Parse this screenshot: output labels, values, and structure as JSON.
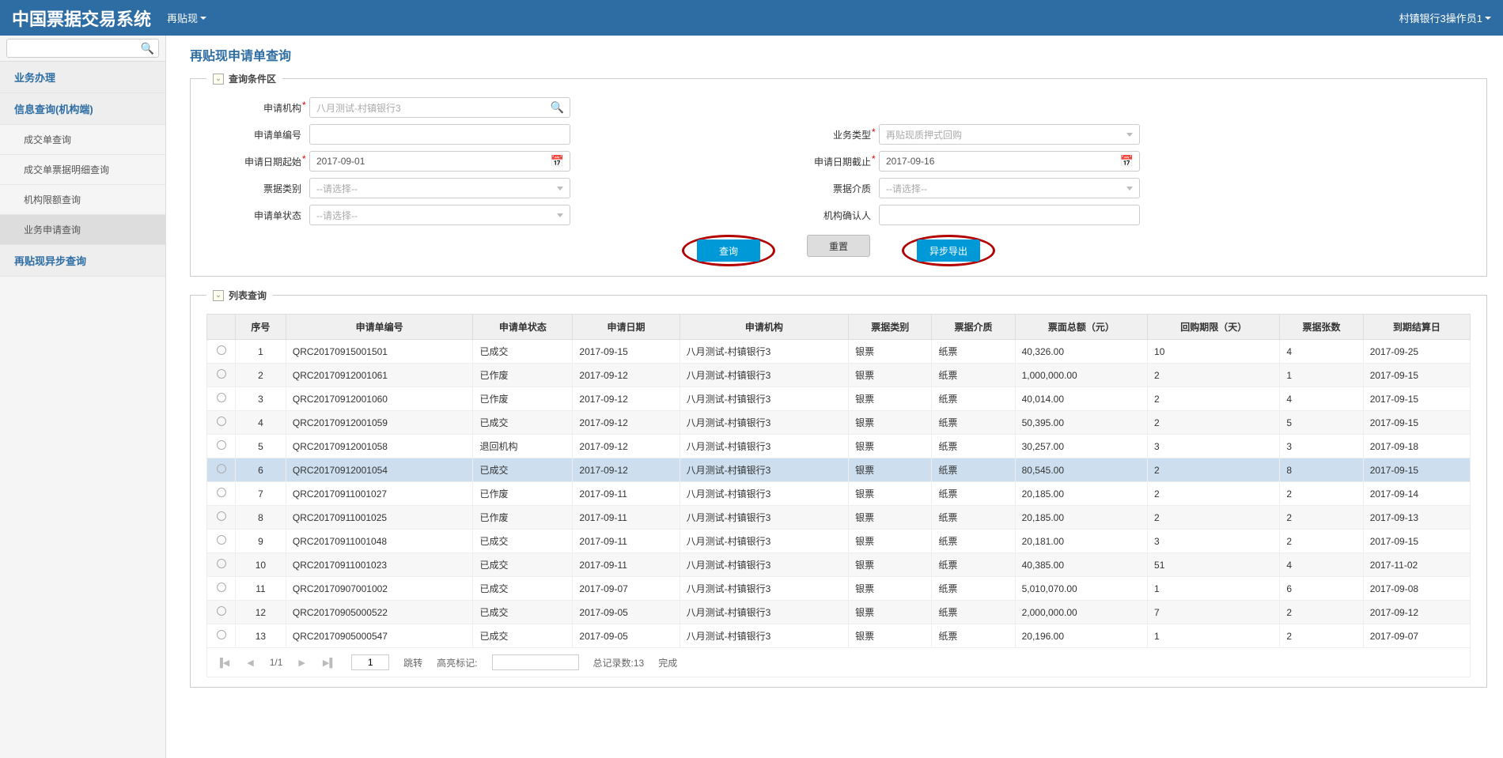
{
  "header": {
    "title": "中国票据交易系统",
    "menu": "再贴现",
    "user": "村镇银行3操作员1"
  },
  "sidebar": {
    "search_placeholder": "",
    "items": [
      {
        "label": "业务办理",
        "type": "bold"
      },
      {
        "label": "信息查询(机构端)",
        "type": "bold"
      },
      {
        "label": "成交单查询",
        "type": "sub"
      },
      {
        "label": "成交单票据明细查询",
        "type": "sub"
      },
      {
        "label": "机构限额查询",
        "type": "sub"
      },
      {
        "label": "业务申请查询",
        "type": "sub",
        "active": true
      },
      {
        "label": "再贴现异步查询",
        "type": "bold"
      }
    ]
  },
  "page": {
    "title": "再贴现申请单查询",
    "query_legend": "查询条件区",
    "list_legend": "列表查询"
  },
  "form": {
    "labels": {
      "apply_org": "申请机构",
      "apply_no": "申请单编号",
      "biz_type": "业务类型",
      "date_from": "申请日期起始",
      "date_to": "申请日期截止",
      "ticket_class": "票据类别",
      "ticket_medium": "票据介质",
      "apply_status": "申请单状态",
      "org_confirm": "机构确认人"
    },
    "values": {
      "apply_org": "八月测试-村镇银行3",
      "apply_no": "",
      "biz_type": "再贴现质押式回购",
      "date_from": "2017-09-01",
      "date_to": "2017-09-16",
      "ticket_class": "--请选择--",
      "ticket_medium": "--请选择--",
      "apply_status": "--请选择--",
      "org_confirm": ""
    },
    "buttons": {
      "query": "查询",
      "reset": "重置",
      "export": "异步导出"
    }
  },
  "table": {
    "headers": [
      "序号",
      "申请单编号",
      "申请单状态",
      "申请日期",
      "申请机构",
      "票据类别",
      "票据介质",
      "票面总额（元）",
      "回购期限（天）",
      "票据张数",
      "到期结算日"
    ],
    "rows": [
      {
        "seq": "1",
        "no": "QRC20170915001501",
        "status": "已成交",
        "date": "2017-09-15",
        "org": "八月测试-村镇银行3",
        "class": "银票",
        "medium": "纸票",
        "amount": "40,326.00",
        "term": "10",
        "count": "4",
        "settle": "2017-09-25"
      },
      {
        "seq": "2",
        "no": "QRC20170912001061",
        "status": "已作废",
        "date": "2017-09-12",
        "org": "八月测试-村镇银行3",
        "class": "银票",
        "medium": "纸票",
        "amount": "1,000,000.00",
        "term": "2",
        "count": "1",
        "settle": "2017-09-15"
      },
      {
        "seq": "3",
        "no": "QRC20170912001060",
        "status": "已作废",
        "date": "2017-09-12",
        "org": "八月测试-村镇银行3",
        "class": "银票",
        "medium": "纸票",
        "amount": "40,014.00",
        "term": "2",
        "count": "4",
        "settle": "2017-09-15"
      },
      {
        "seq": "4",
        "no": "QRC20170912001059",
        "status": "已成交",
        "date": "2017-09-12",
        "org": "八月测试-村镇银行3",
        "class": "银票",
        "medium": "纸票",
        "amount": "50,395.00",
        "term": "2",
        "count": "5",
        "settle": "2017-09-15"
      },
      {
        "seq": "5",
        "no": "QRC20170912001058",
        "status": "退回机构",
        "date": "2017-09-12",
        "org": "八月测试-村镇银行3",
        "class": "银票",
        "medium": "纸票",
        "amount": "30,257.00",
        "term": "3",
        "count": "3",
        "settle": "2017-09-18"
      },
      {
        "seq": "6",
        "no": "QRC20170912001054",
        "status": "已成交",
        "date": "2017-09-12",
        "org": "八月测试-村镇银行3",
        "class": "银票",
        "medium": "纸票",
        "amount": "80,545.00",
        "term": "2",
        "count": "8",
        "settle": "2017-09-15",
        "highlight": true
      },
      {
        "seq": "7",
        "no": "QRC20170911001027",
        "status": "已作废",
        "date": "2017-09-11",
        "org": "八月测试-村镇银行3",
        "class": "银票",
        "medium": "纸票",
        "amount": "20,185.00",
        "term": "2",
        "count": "2",
        "settle": "2017-09-14"
      },
      {
        "seq": "8",
        "no": "QRC20170911001025",
        "status": "已作废",
        "date": "2017-09-11",
        "org": "八月测试-村镇银行3",
        "class": "银票",
        "medium": "纸票",
        "amount": "20,185.00",
        "term": "2",
        "count": "2",
        "settle": "2017-09-13"
      },
      {
        "seq": "9",
        "no": "QRC20170911001048",
        "status": "已成交",
        "date": "2017-09-11",
        "org": "八月测试-村镇银行3",
        "class": "银票",
        "medium": "纸票",
        "amount": "20,181.00",
        "term": "3",
        "count": "2",
        "settle": "2017-09-15"
      },
      {
        "seq": "10",
        "no": "QRC20170911001023",
        "status": "已成交",
        "date": "2017-09-11",
        "org": "八月测试-村镇银行3",
        "class": "银票",
        "medium": "纸票",
        "amount": "40,385.00",
        "term": "51",
        "count": "4",
        "settle": "2017-11-02"
      },
      {
        "seq": "11",
        "no": "QRC20170907001002",
        "status": "已成交",
        "date": "2017-09-07",
        "org": "八月测试-村镇银行3",
        "class": "银票",
        "medium": "纸票",
        "amount": "5,010,070.00",
        "term": "1",
        "count": "6",
        "settle": "2017-09-08"
      },
      {
        "seq": "12",
        "no": "QRC20170905000522",
        "status": "已成交",
        "date": "2017-09-05",
        "org": "八月测试-村镇银行3",
        "class": "银票",
        "medium": "纸票",
        "amount": "2,000,000.00",
        "term": "7",
        "count": "2",
        "settle": "2017-09-12"
      },
      {
        "seq": "13",
        "no": "QRC20170905000547",
        "status": "已成交",
        "date": "2017-09-05",
        "org": "八月测试-村镇银行3",
        "class": "银票",
        "medium": "纸票",
        "amount": "20,196.00",
        "term": "1",
        "count": "2",
        "settle": "2017-09-07"
      }
    ]
  },
  "pager": {
    "page_of": "1/1",
    "page_input": "1",
    "jump": "跳转",
    "highlight_label": "高亮标记:",
    "total": "总记录数:13",
    "status": "完成"
  }
}
